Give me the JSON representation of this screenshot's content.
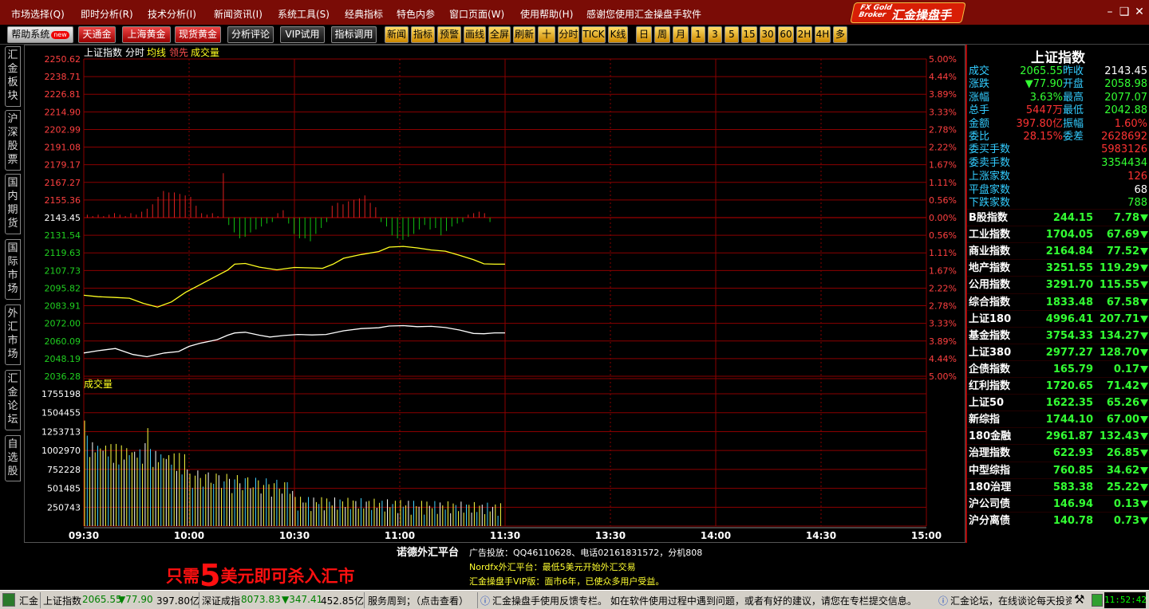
{
  "menu": [
    "市场选择(Q)",
    "即时分析(R)",
    "技术分析(I)",
    "新闻资讯(I)",
    "系统工具(S)",
    "经典指标",
    "特色内参",
    "窗口页面(W)",
    "使用帮助(H)",
    "感谢您使用汇金操盘手软件"
  ],
  "brand": {
    "line1": "FX Gold",
    "line2": "Broker",
    "name": "汇金操盘手"
  },
  "toolbar": {
    "help": "帮助系统",
    "help_badge": "new",
    "tiantong": "天通金",
    "shanghai": "上海黄金",
    "spot": "现货黄金",
    "analysis": "分析评论",
    "vip": "VIP试用",
    "indicator": "指标调用",
    "gold": [
      "新闻",
      "指标",
      "预警",
      "画线",
      "全屏",
      "刷新",
      "十",
      "分时",
      "TICK",
      "K线"
    ],
    "periods": [
      "日",
      "周",
      "月",
      "1",
      "3",
      "5",
      "15",
      "30",
      "60",
      "2H",
      "4H",
      "多"
    ]
  },
  "sidetabs": [
    "汇金板块",
    "沪深股票",
    "国内期货",
    "国际市场",
    "外汇市场",
    "汇金论坛",
    "自选股"
  ],
  "chart": {
    "header": [
      "上证指数",
      "分时",
      "均线",
      "领先",
      "成交量"
    ],
    "price_ticks": [
      "2250.62",
      "2238.71",
      "2226.81",
      "2214.90",
      "2202.99",
      "2191.08",
      "2179.17",
      "2167.27",
      "2155.36",
      "2143.45",
      "2131.54",
      "2119.63",
      "2107.73",
      "2095.82",
      "2083.91",
      "2072.00",
      "2060.09",
      "2048.19",
      "2036.28"
    ],
    "pct_ticks": [
      "5.00%",
      "4.44%",
      "3.89%",
      "3.33%",
      "2.78%",
      "2.22%",
      "1.67%",
      "1.11%",
      "0.56%",
      "0.00%",
      "0.56%",
      "1.11%",
      "1.67%",
      "2.22%",
      "2.78%",
      "3.33%",
      "3.89%",
      "4.44%",
      "5.00%"
    ],
    "vol_label": "成交量",
    "vol_ticks": [
      "1755198",
      "1504455",
      "1253713",
      "1002970",
      "752228",
      "501485",
      "250743"
    ],
    "time_ticks": [
      "09:30",
      "10:00",
      "10:30",
      "11:00",
      "11:30",
      "13:30",
      "14:00",
      "14:30",
      "15:00"
    ],
    "colors": {
      "up": "#e02020",
      "down": "#10c010",
      "price": "#ffffff",
      "avg": "#ffff20",
      "grid": "#8b0000"
    }
  },
  "panel": {
    "title": "上证指数",
    "quotes": [
      {
        "l1": "成交",
        "v1": "2065.55",
        "c1": "#3f3",
        "l2": "昨收",
        "v2": "2143.45",
        "c2": "#fff"
      },
      {
        "l1": "涨跌",
        "v1": "▼77.90",
        "c1": "#3f3",
        "l2": "开盘",
        "v2": "2058.98",
        "c2": "#3f3"
      },
      {
        "l1": "涨幅",
        "v1": "3.63%",
        "c1": "#3f3",
        "l2": "最高",
        "v2": "2077.07",
        "c2": "#3f3"
      },
      {
        "l1": "总手",
        "v1": "5447万",
        "c1": "#f33",
        "l2": "最低",
        "v2": "2042.88",
        "c2": "#3f3"
      },
      {
        "l1": "金额",
        "v1": "397.80亿",
        "c1": "#f33",
        "l2": "振幅",
        "v2": "1.60%",
        "c2": "#f33"
      },
      {
        "l1": "委比",
        "v1": "28.15%",
        "c1": "#f33",
        "l2": "委差",
        "v2": "2628692",
        "c2": "#f33"
      }
    ],
    "orders": [
      {
        "l": "委买手数",
        "v": "5983126",
        "c": "#f33"
      },
      {
        "l": "委卖手数",
        "v": "3354434",
        "c": "#3f3"
      }
    ],
    "breadth": [
      {
        "l": "上涨家数",
        "v": "126",
        "c": "#f33"
      },
      {
        "l": "平盘家数",
        "v": "68",
        "c": "#fff"
      },
      {
        "l": "下跌家数",
        "v": "788",
        "c": "#3f3"
      }
    ],
    "indices": [
      {
        "n": "B股指数",
        "p": "244.15",
        "c": "7.78"
      },
      {
        "n": "工业指数",
        "p": "1704.05",
        "c": "67.69"
      },
      {
        "n": "商业指数",
        "p": "2164.84",
        "c": "77.52"
      },
      {
        "n": "地产指数",
        "p": "3251.55",
        "c": "119.29"
      },
      {
        "n": "公用指数",
        "p": "3291.70",
        "c": "115.55"
      },
      {
        "n": "综合指数",
        "p": "1833.48",
        "c": "67.58"
      },
      {
        "n": "上证180",
        "p": "4996.41",
        "c": "207.71"
      },
      {
        "n": "基金指数",
        "p": "3754.33",
        "c": "134.27"
      },
      {
        "n": "上证380",
        "p": "2977.27",
        "c": "128.70"
      },
      {
        "n": "企债指数",
        "p": "165.79",
        "c": "0.17"
      },
      {
        "n": "红利指数",
        "p": "1720.65",
        "c": "71.42"
      },
      {
        "n": "上证50",
        "p": "1622.35",
        "c": "65.26"
      },
      {
        "n": "新综指",
        "p": "1744.10",
        "c": "67.00"
      },
      {
        "n": "180金融",
        "p": "2961.87",
        "c": "132.43"
      },
      {
        "n": "治理指数",
        "p": "622.93",
        "c": "26.85"
      },
      {
        "n": "中型综指",
        "p": "760.85",
        "c": "34.62"
      },
      {
        "n": "180治理",
        "p": "583.38",
        "c": "25.22"
      },
      {
        "n": "沪公司债",
        "p": "146.94",
        "c": "0.13"
      },
      {
        "n": "沪分离债",
        "p": "140.78",
        "c": "0.73"
      }
    ]
  },
  "ad": {
    "slogan_a": "只需",
    "slogan_num": "5",
    "slogan_b": "美元即可杀入汇市",
    "platform": "诺德外汇平台",
    "line1": "广告投放：QQ46110628、电话02161831572，分机808",
    "line2": "Nordfx外汇平台：最低5美元开始外汇交易",
    "line3": "汇金操盘手VIP版：面市6年，已使众多用户受益。"
  },
  "status": {
    "app": "汇金",
    "sh_name": "上证指数",
    "sh_price": "2065.55",
    "sh_chg": "▼77.90",
    "sh_amt": "397.80亿",
    "sz_name": "深证成指",
    "sz_price": "8073.83",
    "sz_chg": "▼347.41",
    "sz_amt": "452.85亿",
    "service": "服务周到；（点击查看）",
    "notice": "汇金操盘手使用反馈专栏。  如在软件使用过程中遇到问题，或者有好的建议，请您在专栏提交信息。",
    "forum": "汇金论坛，在线谈论每天投资",
    "clock": "11:52:42"
  }
}
